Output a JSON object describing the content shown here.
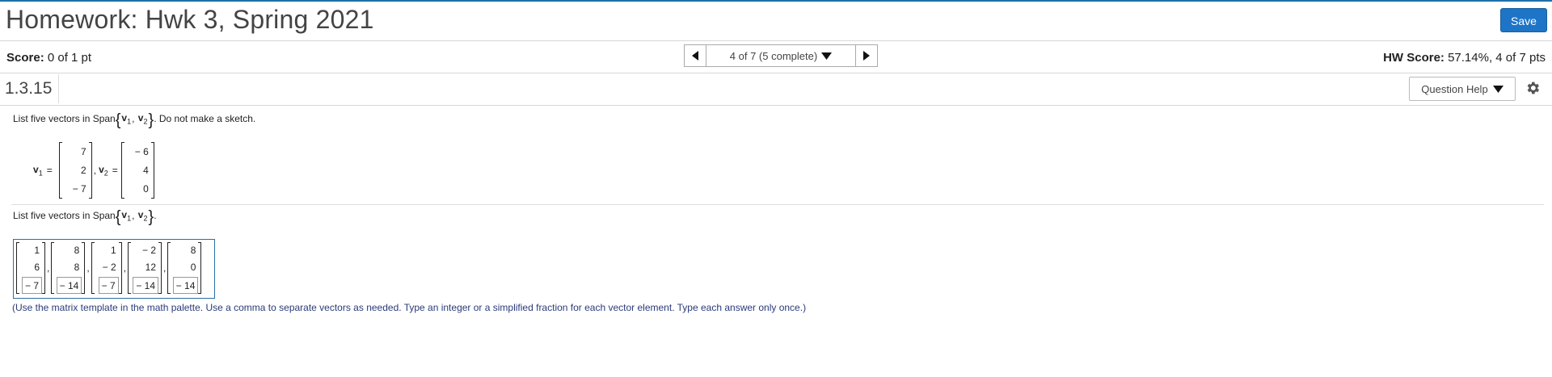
{
  "header": {
    "title": "Homework: Hwk 3, Spring 2021",
    "save_label": "Save"
  },
  "score_bar": {
    "score_label": "Score:",
    "score_value": "0 of 1 pt",
    "nav_label": "4 of 7 (5 complete)",
    "hw_score_label": "HW Score:",
    "hw_score_value": "57.14%, 4 of 7 pts"
  },
  "question_bar": {
    "number": "1.3.15",
    "help_label": "Question Help"
  },
  "question": {
    "prompt_prefix": "List five vectors in Span",
    "prompt_suffix": ". Do not make a sketch.",
    "span_v1": "v",
    "span_v1_sub": "1",
    "span_v2": "v",
    "span_v2_sub": "2",
    "v1_label": "v",
    "v1_sub": "1",
    "v2_label": "v",
    "v2_sub": "2",
    "v1": [
      "7",
      "2",
      "− 7"
    ],
    "v2": [
      "− 6",
      "4",
      "0"
    ]
  },
  "answer": {
    "prompt_prefix": "List five vectors in Span",
    "prompt_suffix": ".",
    "vectors": [
      [
        "1",
        "6",
        "− 7"
      ],
      [
        "8",
        "8",
        "− 14"
      ],
      [
        "1",
        "− 2",
        "− 7"
      ],
      [
        "− 2",
        "12",
        "− 14"
      ],
      [
        "8",
        "0",
        "− 14"
      ]
    ],
    "instructions": "(Use the matrix template in the math palette. Use a comma to separate vectors as needed. Type an integer or a simplified fraction for each vector element. Type each answer only once.)"
  },
  "colors": {
    "accent": "#1e74c6",
    "top_border": "#1b6fa8",
    "instruction_text": "#2a3a7a"
  },
  "icons": [
    "prev-arrow-icon",
    "chevron-down-icon",
    "next-arrow-icon",
    "gear-icon"
  ]
}
